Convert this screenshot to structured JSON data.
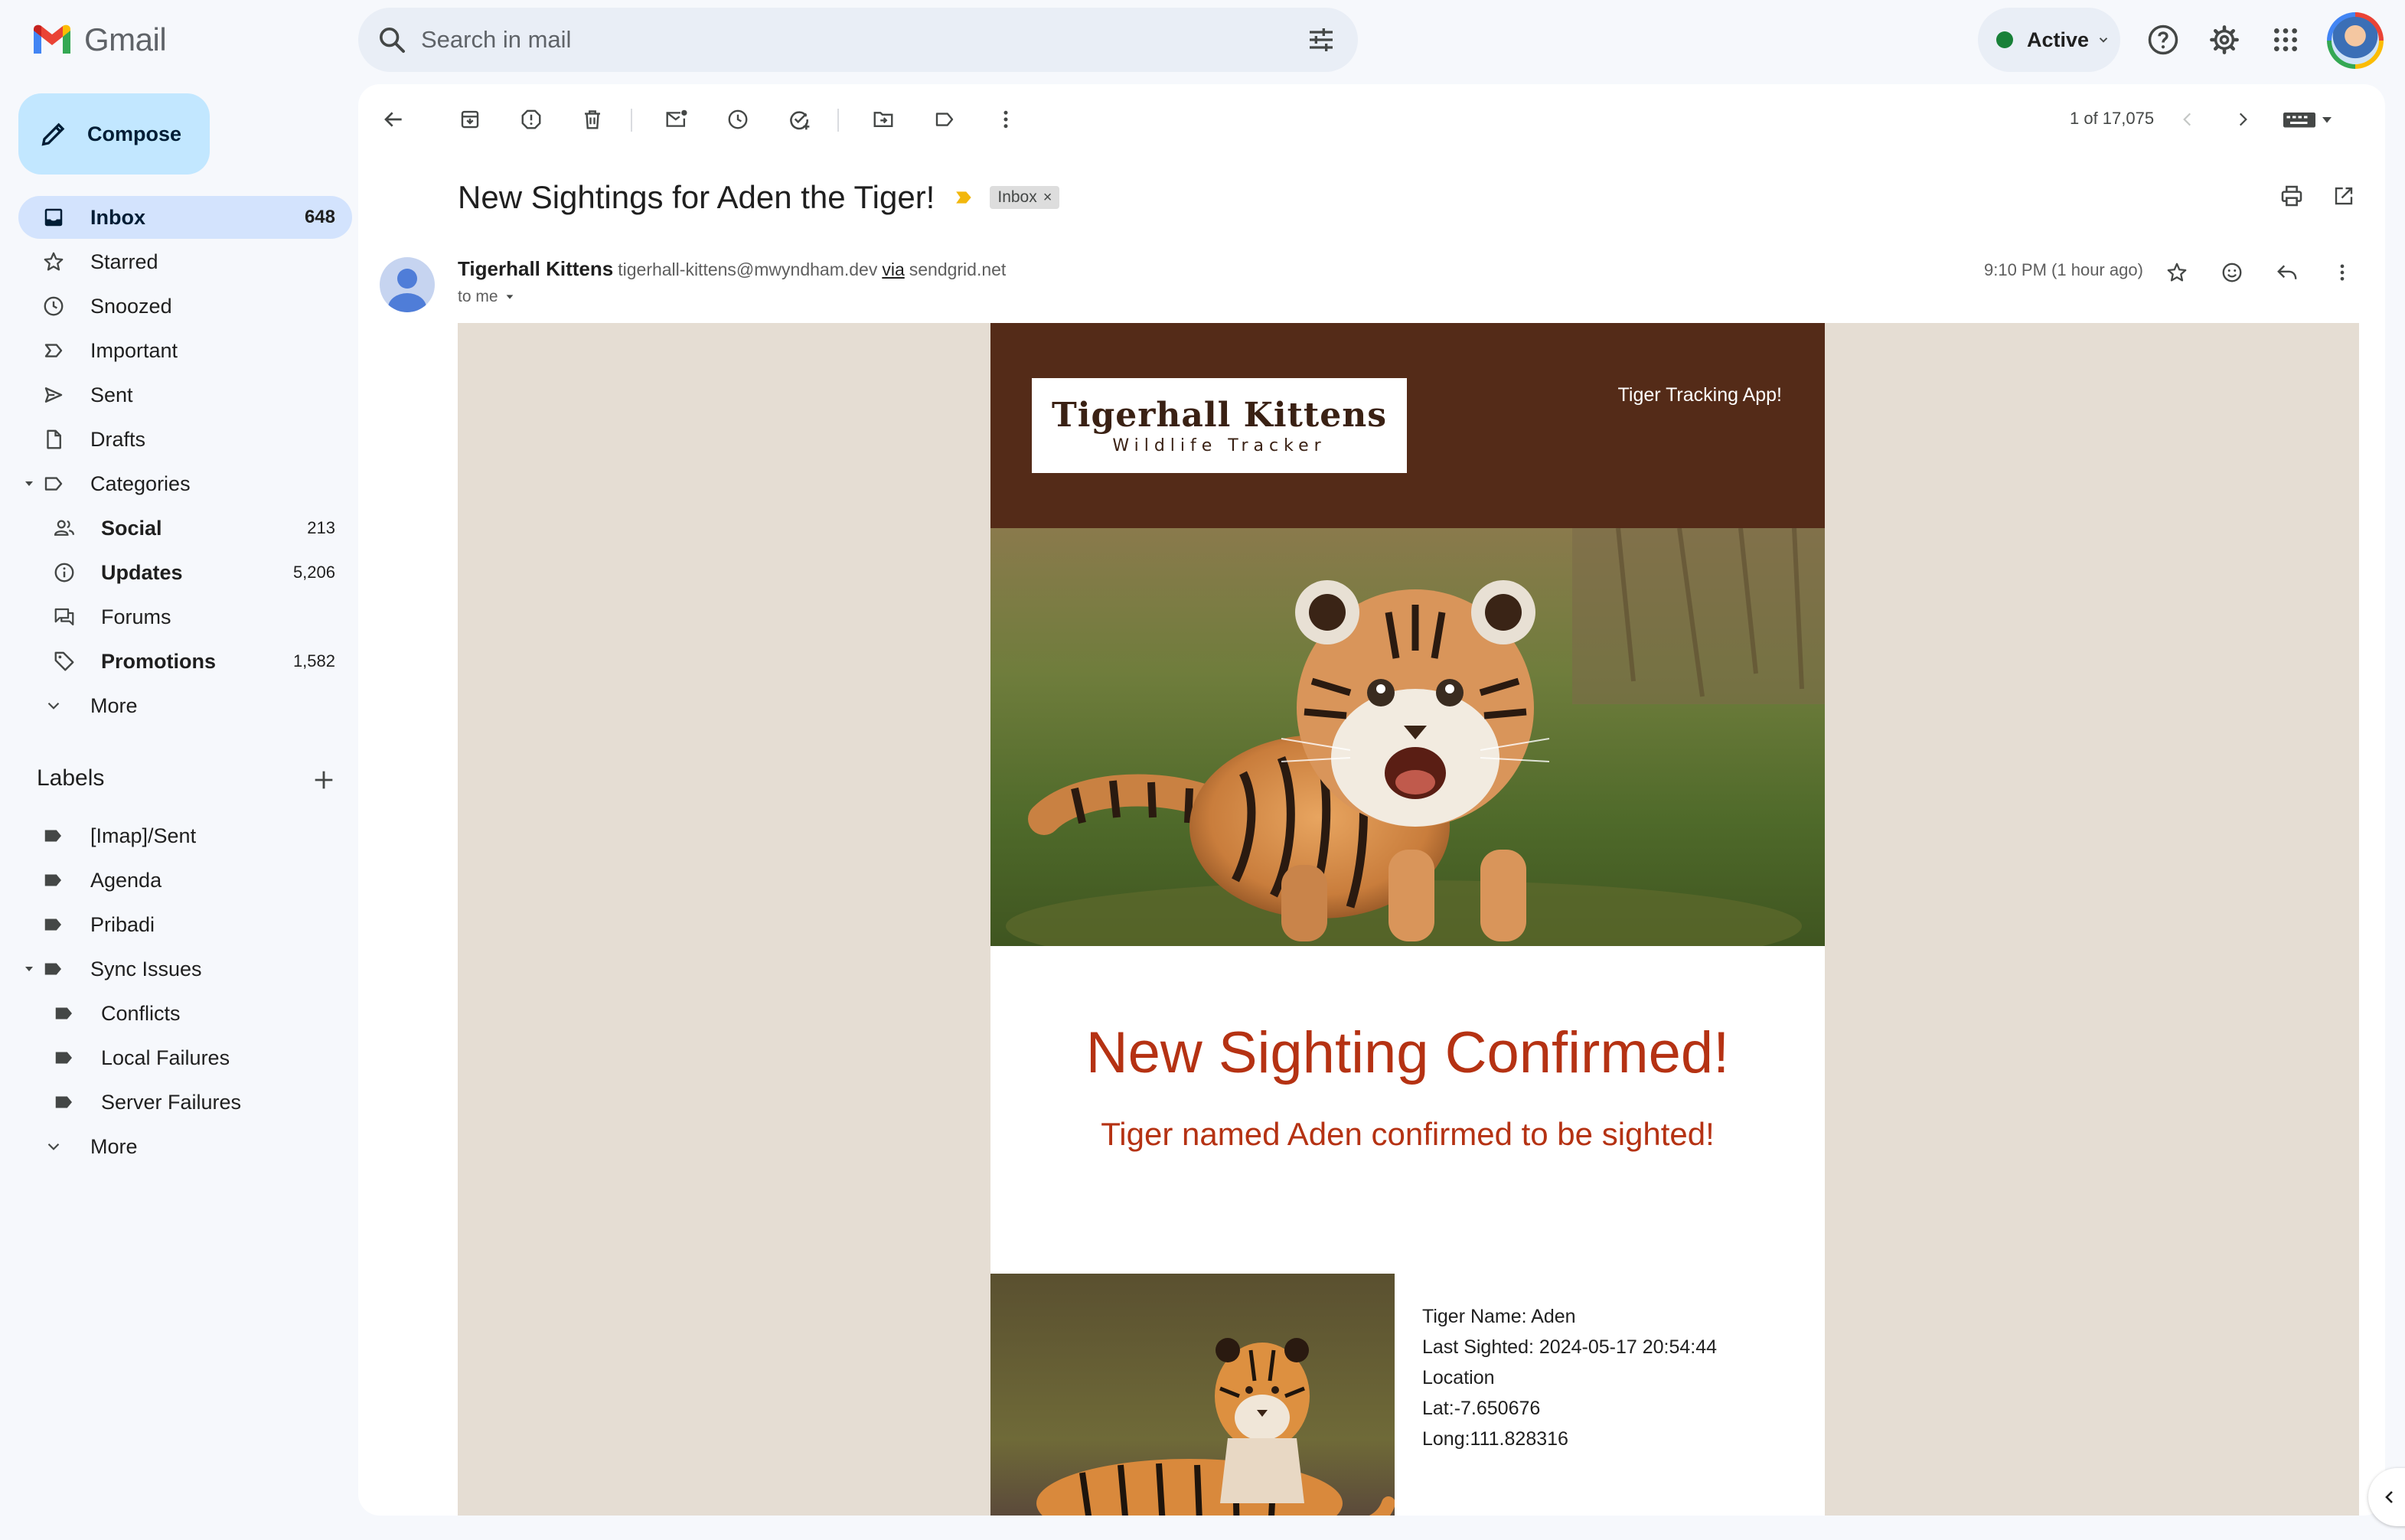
{
  "app": {
    "name": "Gmail"
  },
  "search": {
    "placeholder": "Search in mail"
  },
  "status": {
    "label": "Active",
    "color": "#188038"
  },
  "compose": {
    "label": "Compose"
  },
  "nav": {
    "inbox": {
      "label": "Inbox",
      "count": "648"
    },
    "starred": {
      "label": "Starred"
    },
    "snoozed": {
      "label": "Snoozed"
    },
    "important": {
      "label": "Important"
    },
    "sent": {
      "label": "Sent"
    },
    "drafts": {
      "label": "Drafts"
    },
    "categories": {
      "label": "Categories"
    },
    "social": {
      "label": "Social",
      "count": "213"
    },
    "updates": {
      "label": "Updates",
      "count": "5,206"
    },
    "forums": {
      "label": "Forums"
    },
    "promotions": {
      "label": "Promotions",
      "count": "1,582"
    },
    "more1": {
      "label": "More"
    }
  },
  "labels": {
    "heading": "Labels",
    "items": {
      "imap_sent": "[Imap]/Sent",
      "agenda": "Agenda",
      "pribadi": "Pribadi",
      "sync_issues": "Sync Issues",
      "conflicts": "Conflicts",
      "local_failures": "Local Failures",
      "server_failures": "Server Failures"
    },
    "more": "More"
  },
  "toolbar": {
    "pager": "1 of 17,075"
  },
  "message": {
    "subject": "New Sightings for Aden the Tiger!",
    "label_chip": "Inbox",
    "label_chip_close": "×",
    "sender_name": "Tigerhall Kittens",
    "sender_email": "tigerhall-kittens@mwyndham.dev",
    "via": "via",
    "via_domain": "sendgrid.net",
    "to": "to me",
    "time": "9:10 PM (1 hour ago)"
  },
  "email": {
    "logo_title": "Tigerhall Kittens",
    "logo_subtitle": "Wildlife Tracker",
    "tagline": "Tiger Tracking App!",
    "heading": "New Sighting Confirmed!",
    "subheading": "Tiger named Aden confirmed to be sighted!",
    "details": {
      "name": "Tiger Name: Aden",
      "last_sighted": "Last Sighted: 2024-05-17 20:54:44",
      "location": "Location",
      "lat": "Lat:-7.650676",
      "long": "Long:111.828316"
    },
    "colors": {
      "header_bg": "#542b18",
      "body_bg": "#e5ddd3",
      "accent": "#b53213"
    }
  }
}
